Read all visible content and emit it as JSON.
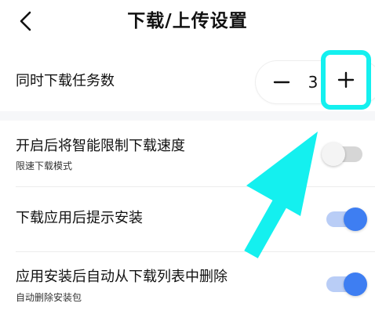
{
  "header": {
    "title": "下载/上传设置",
    "back_icon": "chevron-left-icon"
  },
  "concurrent": {
    "label": "同时下载任务数",
    "value": "3",
    "minus_icon": "minus-icon",
    "plus_icon": "plus-icon"
  },
  "settings": [
    {
      "label": "开启后将智能限制下载速度",
      "sublabel": "限速下载模式",
      "enabled": false
    },
    {
      "label": "下载应用后提示安装",
      "enabled": true
    },
    {
      "label": "应用安装后自动从下载列表中删除",
      "sublabel": "自动删除安装包",
      "enabled": true
    }
  ],
  "colors": {
    "highlight": "#14f0ef",
    "toggle_on": "#3e7ef2",
    "toggle_on_track": "#b9cdf6",
    "toggle_off_track": "#d6d6d6"
  }
}
